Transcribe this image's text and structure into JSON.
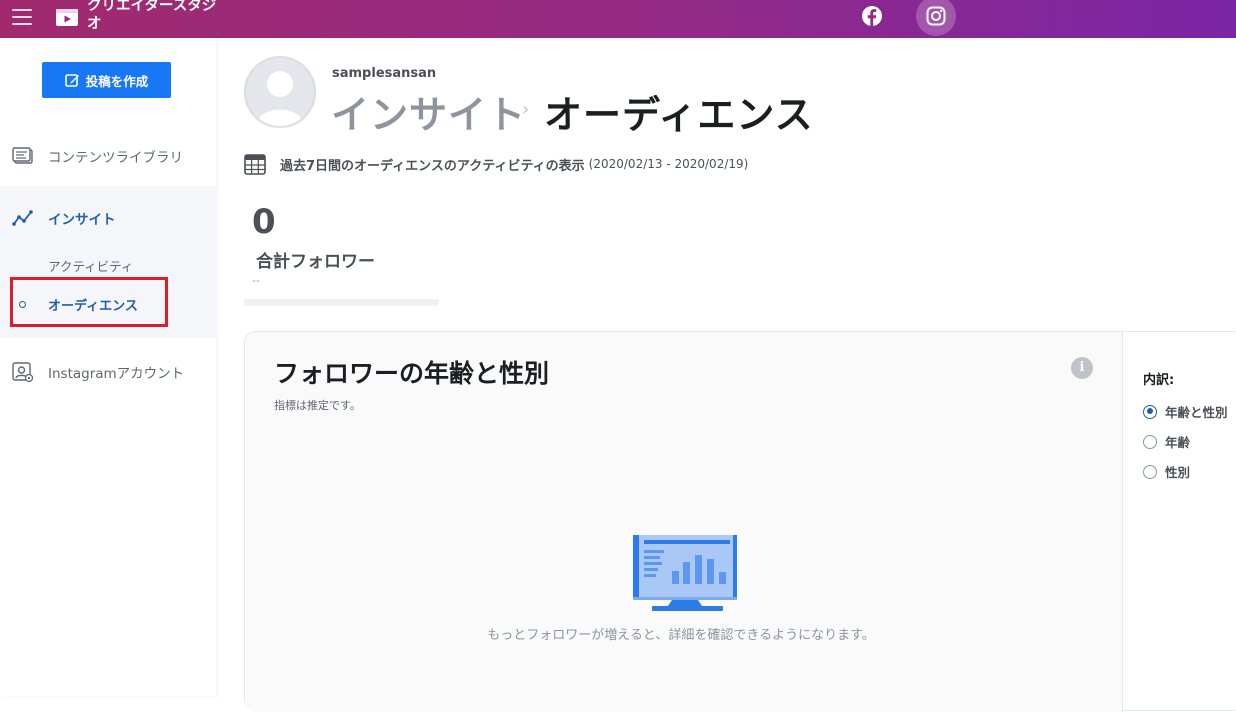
{
  "topbar": {
    "app_title": "クリエイタースタジオ",
    "icons": {
      "menu": "hamburger-icon",
      "logo": "creator-studio-logo",
      "facebook": "facebook-icon",
      "instagram": "instagram-icon"
    }
  },
  "sidebar": {
    "create_post_label": "投稿を作成",
    "items": [
      {
        "label": "コンテンツライブラリ",
        "icon": "content-library-icon"
      },
      {
        "label": "インサイト",
        "icon": "insights-icon"
      },
      {
        "label": "Instagramアカウント",
        "icon": "instagram-account-icon"
      }
    ],
    "insight_sub": [
      {
        "label": "アクティビティ"
      },
      {
        "label": "オーディエンス"
      }
    ]
  },
  "header": {
    "username": "samplesansan",
    "breadcrumb_parent": "インサイト",
    "breadcrumb_separator": "›",
    "breadcrumb_current": "オーディエンス"
  },
  "date": {
    "label": "過去7日間のオーディエンスのアクティビティの表示",
    "range": "(2020/02/13 - 2020/02/19)"
  },
  "followers": {
    "count": "0",
    "label": "合計フォロワー",
    "delta": "--"
  },
  "card": {
    "title": "フォロワーの年齢と性別",
    "subtitle": "指標は推定です。",
    "info_glyph": "i",
    "empty_message": "もっとフォロワーが増えると、詳細を確認できるようになります。",
    "breakdown_title": "内訳:",
    "options": [
      {
        "label": "年齢と性別",
        "selected": true
      },
      {
        "label": "年齢",
        "selected": false
      },
      {
        "label": "性別",
        "selected": false
      }
    ]
  },
  "colors": {
    "topbar_start": "#a12a6e",
    "topbar_end": "#7a26a6",
    "primary_button": "#1877f2",
    "active_nav": "#1d5fa8",
    "highlight_box": "#d9202a"
  }
}
